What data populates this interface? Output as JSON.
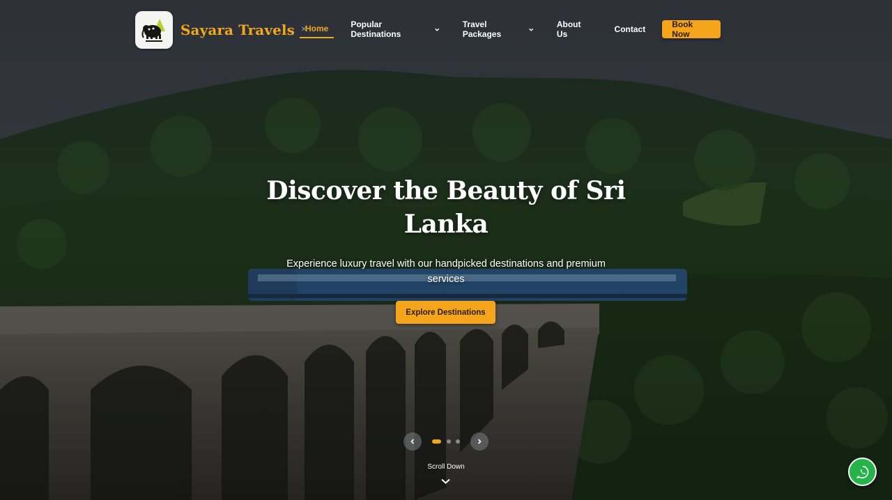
{
  "brand": {
    "name": "Sayara Travels",
    "logo_icon": "elephant-logo-icon"
  },
  "nav": {
    "close_glyph": "×",
    "items": [
      {
        "label": "Home",
        "active": true
      },
      {
        "label": "Popular Destinations",
        "dropdown": true
      },
      {
        "label": "Travel Packages",
        "dropdown": true
      },
      {
        "label": "About Us"
      },
      {
        "label": "Contact"
      }
    ],
    "cta": "Book Now"
  },
  "hero": {
    "headline": "Discover the Beauty of Sri Lanka",
    "subheadline": "Experience luxury travel with our handpicked destinations and premium services",
    "button": "Explore Destinations",
    "slides_total": 3,
    "active_slide": 1,
    "scroll_label": "Scroll Down"
  },
  "floating": {
    "whatsapp_icon": "whatsapp-icon"
  },
  "colors": {
    "accent": "#f4a51c",
    "brand_text": "#f0a81e",
    "whatsapp": "#25b34a"
  }
}
